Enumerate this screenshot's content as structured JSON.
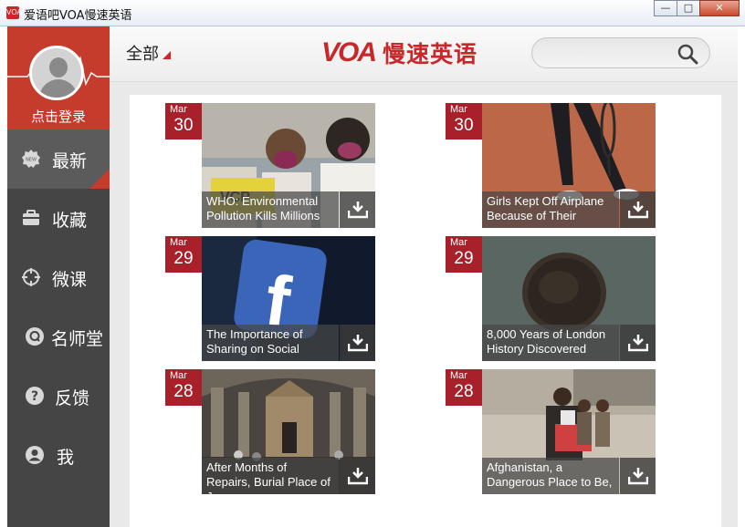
{
  "window": {
    "title": "爱语吧VOA慢速英语",
    "app_icon_text": "VOA",
    "buttons": {
      "minimize": "—",
      "maximize": "□",
      "close": "✕"
    }
  },
  "sidebar": {
    "login_label": "点击登录",
    "items": [
      {
        "label": "最新",
        "icon": "new-badge-icon",
        "active": true
      },
      {
        "label": "收藏",
        "icon": "briefcase-icon",
        "active": false
      },
      {
        "label": "微课",
        "icon": "crosshair-icon",
        "active": false
      },
      {
        "label": "名师堂",
        "icon": "q-circle-icon",
        "active": false
      },
      {
        "label": "反馈",
        "icon": "question-circle-icon",
        "active": false
      },
      {
        "label": "我",
        "icon": "user-circle-icon",
        "active": false
      }
    ]
  },
  "header": {
    "filter_label": "全部",
    "logo_voa": "VOA",
    "logo_text": "慢速英语",
    "search_placeholder": ""
  },
  "articles": [
    {
      "month": "Mar",
      "day": "30",
      "title": "WHO: Environmental Pollution Kills Millions",
      "image": "children-wearing-masks"
    },
    {
      "month": "Mar",
      "day": "30",
      "title": "Girls Kept Off Airplane Because of Their",
      "image": "tennis-player-clay-court"
    },
    {
      "month": "Mar",
      "day": "29",
      "title": "The Importance of Sharing on Social",
      "image": "facebook-logo"
    },
    {
      "month": "Mar",
      "day": "29",
      "title": "8,000 Years of London History Discovered",
      "image": "ancient-coin"
    },
    {
      "month": "Mar",
      "day": "28",
      "title": "After Months of Repairs, Burial Place of Jesus",
      "image": "church-interior"
    },
    {
      "month": "Mar",
      "day": "28",
      "title": "Afghanistan, a Dangerous Place to Be,",
      "image": "children-with-cart"
    }
  ],
  "colors": {
    "accent": "#c53b2c",
    "date_badge": "#a8202a",
    "sidebar_bg": "#454545",
    "sidebar_active": "#5b5b5b"
  }
}
